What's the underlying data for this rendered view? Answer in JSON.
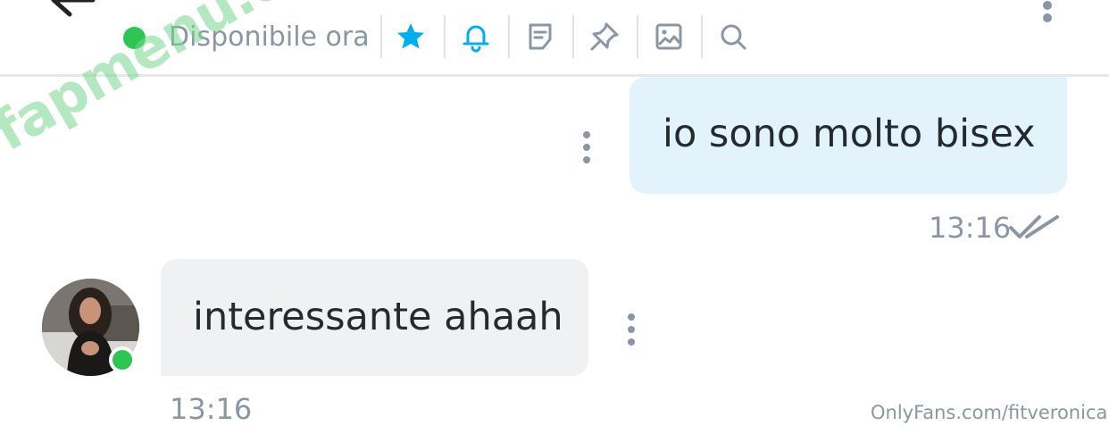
{
  "header": {
    "status_text": "Disponibile ora",
    "status_color": "#2dc653",
    "accent_color": "#00aff0",
    "icons": [
      "back-arrow-icon",
      "star-icon",
      "bell-icon",
      "note-icon",
      "pin-icon",
      "image-icon",
      "search-icon",
      "more-vertical-icon"
    ]
  },
  "messages": [
    {
      "direction": "out",
      "text": "io sono molto bisex",
      "time": "13:16",
      "read": true
    },
    {
      "direction": "in",
      "text": "interessante ahaah",
      "time": "13:16"
    }
  ],
  "watermarks": {
    "site": "fapmenu.com",
    "source": "OnlyFans.com/fitveronica"
  }
}
